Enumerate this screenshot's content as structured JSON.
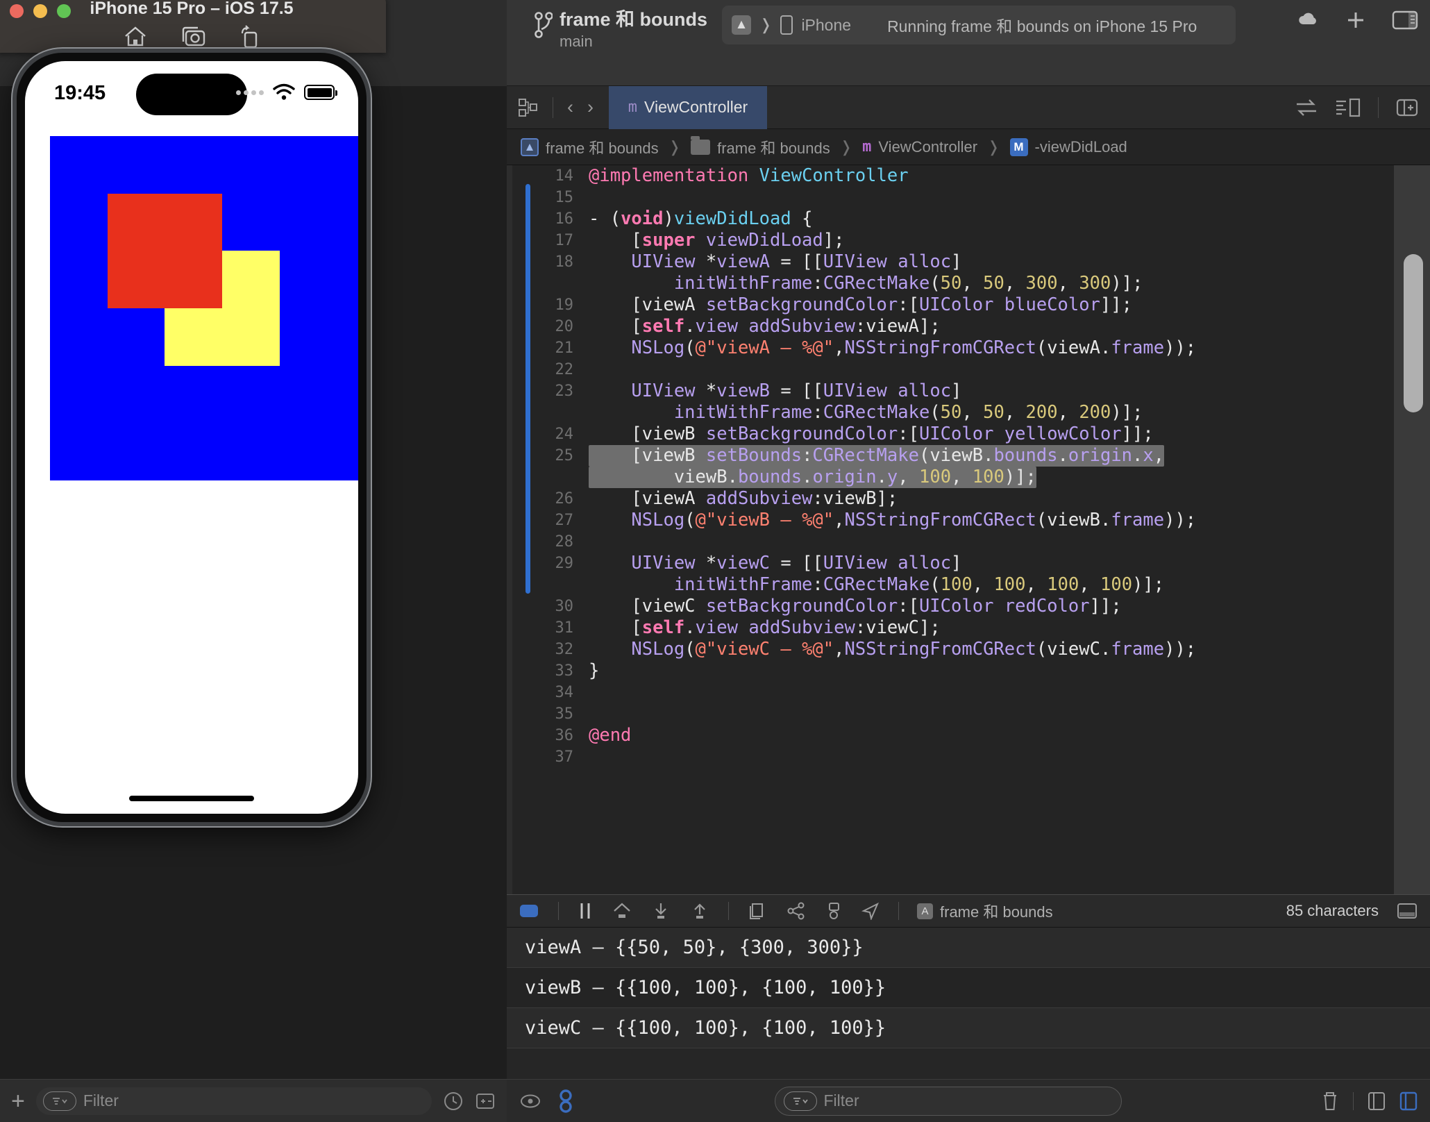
{
  "simulator": {
    "title": "iPhone 15 Pro – iOS 17.5",
    "toolbar": [
      {
        "name": "home-icon",
        "label": "Home"
      },
      {
        "name": "screenshot-icon",
        "label": "Screenshot"
      },
      {
        "name": "rotate-icon",
        "label": "Rotate"
      }
    ],
    "traffic_lights": [
      "close",
      "minimize",
      "zoom"
    ],
    "status_bar": {
      "time": "19:45",
      "cellular": "····",
      "wifi": "wifi-icon",
      "battery": "battery-full-icon"
    },
    "views": [
      {
        "name": "viewA",
        "color": "#0000ff",
        "frame": [
          50,
          50,
          300,
          300
        ]
      },
      {
        "name": "viewB",
        "color": "#ffff66",
        "frame": [
          100,
          100,
          100,
          100
        ]
      },
      {
        "name": "viewC",
        "color": "#e8301c",
        "frame": [
          100,
          100,
          100,
          100
        ]
      }
    ]
  },
  "xcode": {
    "branch": {
      "project": "frame 和 bounds",
      "branch": "main"
    },
    "scheme": {
      "app_icon": "A",
      "destination": "iPhone",
      "status": "Running frame 和 bounds on iPhone 15 Pro"
    },
    "toolbar_right": [
      {
        "name": "cloud-icon"
      },
      {
        "name": "add-icon",
        "label": "+"
      },
      {
        "name": "inspector-toggle-icon"
      }
    ],
    "jumpbar": {
      "related-items-icon": "related-items",
      "back_label": "‹",
      "forward_label": "›",
      "tab": {
        "kind": "m",
        "label": "ViewController"
      },
      "right_icons": [
        "compare-versions-icon",
        "minimap-icon",
        "add-editor-icon"
      ]
    },
    "breadcrumb": [
      {
        "icon": "project-icon",
        "label": "frame 和 bounds"
      },
      {
        "icon": "folder-icon",
        "label": "frame 和 bounds"
      },
      {
        "icon": "m-file-icon",
        "label": "ViewController"
      },
      {
        "icon": "method-icon",
        "label": "-viewDidLoad"
      }
    ],
    "code_lines": [
      {
        "num": "14",
        "tokens": [
          [
            "kw",
            "@implementation"
          ],
          [
            "pl",
            " "
          ],
          [
            "tp",
            "ViewController"
          ]
        ]
      },
      {
        "num": "15",
        "tokens": []
      },
      {
        "num": "16",
        "tokens": [
          [
            "pl",
            "- ("
          ],
          [
            "k",
            "void"
          ],
          [
            "pl",
            ")"
          ],
          [
            "tp",
            "viewDidLoad"
          ],
          [
            "pl",
            " {"
          ]
        ]
      },
      {
        "num": "17",
        "tokens": [
          [
            "pl",
            "    ["
          ],
          [
            "k",
            "super"
          ],
          [
            "pl",
            " "
          ],
          [
            "id",
            "viewDidLoad"
          ],
          [
            "pl",
            "];"
          ]
        ]
      },
      {
        "num": "18",
        "tokens": [
          [
            "pl",
            "    "
          ],
          [
            "id",
            "UIView"
          ],
          [
            "pl",
            " *"
          ],
          [
            "id",
            "viewA"
          ],
          [
            "pl",
            " = [["
          ],
          [
            "id",
            "UIView"
          ],
          [
            "pl",
            " "
          ],
          [
            "id",
            "alloc"
          ],
          [
            "pl",
            "]"
          ]
        ]
      },
      {
        "num": "",
        "tokens": [
          [
            "pl",
            "        "
          ],
          [
            "id",
            "initWithFrame"
          ],
          [
            "pl",
            ":"
          ],
          [
            "id",
            "CGRectMake"
          ],
          [
            "pl",
            "("
          ],
          [
            "nm",
            "50"
          ],
          [
            "pl",
            ", "
          ],
          [
            "nm",
            "50"
          ],
          [
            "pl",
            ", "
          ],
          [
            "nm",
            "300"
          ],
          [
            "pl",
            ", "
          ],
          [
            "nm",
            "300"
          ],
          [
            "pl",
            ")];"
          ]
        ]
      },
      {
        "num": "19",
        "tokens": [
          [
            "pl",
            "    ["
          ],
          [
            "pl",
            "viewA"
          ],
          [
            "pl",
            " "
          ],
          [
            "id",
            "setBackgroundColor"
          ],
          [
            "pl",
            ":["
          ],
          [
            "id",
            "UIColor"
          ],
          [
            "pl",
            " "
          ],
          [
            "id",
            "blueColor"
          ],
          [
            "pl",
            "]];"
          ]
        ]
      },
      {
        "num": "20",
        "tokens": [
          [
            "pl",
            "    ["
          ],
          [
            "k",
            "self"
          ],
          [
            "pl",
            "."
          ],
          [
            "id",
            "view"
          ],
          [
            "pl",
            " "
          ],
          [
            "id",
            "addSubview"
          ],
          [
            "pl",
            ":"
          ],
          [
            "pl",
            "viewA"
          ],
          [
            "pl",
            "];"
          ]
        ]
      },
      {
        "num": "21",
        "tokens": [
          [
            "pl",
            "    "
          ],
          [
            "id",
            "NSLog"
          ],
          [
            "pl",
            "("
          ],
          [
            "st",
            "@\"viewA — %@\""
          ],
          [
            "pl",
            ","
          ],
          [
            "id",
            "NSStringFromCGRect"
          ],
          [
            "pl",
            "("
          ],
          [
            "pl",
            "viewA"
          ],
          [
            "pl",
            "."
          ],
          [
            "id",
            "frame"
          ],
          [
            "pl",
            "));"
          ]
        ]
      },
      {
        "num": "22",
        "tokens": []
      },
      {
        "num": "23",
        "tokens": [
          [
            "pl",
            "    "
          ],
          [
            "id",
            "UIView"
          ],
          [
            "pl",
            " *"
          ],
          [
            "id",
            "viewB"
          ],
          [
            "pl",
            " = [["
          ],
          [
            "id",
            "UIView"
          ],
          [
            "pl",
            " "
          ],
          [
            "id",
            "alloc"
          ],
          [
            "pl",
            "]"
          ]
        ]
      },
      {
        "num": "",
        "tokens": [
          [
            "pl",
            "        "
          ],
          [
            "id",
            "initWithFrame"
          ],
          [
            "pl",
            ":"
          ],
          [
            "id",
            "CGRectMake"
          ],
          [
            "pl",
            "("
          ],
          [
            "nm",
            "50"
          ],
          [
            "pl",
            ", "
          ],
          [
            "nm",
            "50"
          ],
          [
            "pl",
            ", "
          ],
          [
            "nm",
            "200"
          ],
          [
            "pl",
            ", "
          ],
          [
            "nm",
            "200"
          ],
          [
            "pl",
            ")];"
          ]
        ]
      },
      {
        "num": "24",
        "tokens": [
          [
            "pl",
            "    ["
          ],
          [
            "pl",
            "viewB"
          ],
          [
            "pl",
            " "
          ],
          [
            "id",
            "setBackgroundColor"
          ],
          [
            "pl",
            ":["
          ],
          [
            "id",
            "UIColor"
          ],
          [
            "pl",
            " "
          ],
          [
            "id",
            "yellowColor"
          ],
          [
            "pl",
            "]];"
          ]
        ]
      },
      {
        "num": "25",
        "highlight": true,
        "tokens": [
          [
            "pl",
            "    ["
          ],
          [
            "pl",
            "viewB"
          ],
          [
            "pl",
            " "
          ],
          [
            "id",
            "setBounds"
          ],
          [
            "pl",
            ":"
          ],
          [
            "id",
            "CGRectMake"
          ],
          [
            "pl",
            "("
          ],
          [
            "pl",
            "viewB"
          ],
          [
            "pl",
            "."
          ],
          [
            "id",
            "bounds"
          ],
          [
            "pl",
            "."
          ],
          [
            "id",
            "origin"
          ],
          [
            "pl",
            "."
          ],
          [
            "id",
            "x"
          ],
          [
            "pl",
            ","
          ]
        ]
      },
      {
        "num": "",
        "highlight": true,
        "tokens": [
          [
            "pl",
            "        viewB"
          ],
          [
            "pl",
            "."
          ],
          [
            "id",
            "bounds"
          ],
          [
            "pl",
            "."
          ],
          [
            "id",
            "origin"
          ],
          [
            "pl",
            "."
          ],
          [
            "id",
            "y"
          ],
          [
            "pl",
            ", "
          ],
          [
            "nm",
            "100"
          ],
          [
            "pl",
            ", "
          ],
          [
            "nm",
            "100"
          ],
          [
            "pl",
            ")];"
          ]
        ]
      },
      {
        "num": "26",
        "tokens": [
          [
            "pl",
            "    ["
          ],
          [
            "pl",
            "viewA"
          ],
          [
            "pl",
            " "
          ],
          [
            "id",
            "addSubview"
          ],
          [
            "pl",
            ":"
          ],
          [
            "pl",
            "viewB"
          ],
          [
            "pl",
            "];"
          ]
        ]
      },
      {
        "num": "27",
        "tokens": [
          [
            "pl",
            "    "
          ],
          [
            "id",
            "NSLog"
          ],
          [
            "pl",
            "("
          ],
          [
            "st",
            "@\"viewB — %@\""
          ],
          [
            "pl",
            ","
          ],
          [
            "id",
            "NSStringFromCGRect"
          ],
          [
            "pl",
            "("
          ],
          [
            "pl",
            "viewB"
          ],
          [
            "pl",
            "."
          ],
          [
            "id",
            "frame"
          ],
          [
            "pl",
            "));"
          ]
        ]
      },
      {
        "num": "28",
        "tokens": []
      },
      {
        "num": "29",
        "tokens": [
          [
            "pl",
            "    "
          ],
          [
            "id",
            "UIView"
          ],
          [
            "pl",
            " *"
          ],
          [
            "id",
            "viewC"
          ],
          [
            "pl",
            " = [["
          ],
          [
            "id",
            "UIView"
          ],
          [
            "pl",
            " "
          ],
          [
            "id",
            "alloc"
          ],
          [
            "pl",
            "]"
          ]
        ]
      },
      {
        "num": "",
        "tokens": [
          [
            "pl",
            "        "
          ],
          [
            "id",
            "initWithFrame"
          ],
          [
            "pl",
            ":"
          ],
          [
            "id",
            "CGRectMake"
          ],
          [
            "pl",
            "("
          ],
          [
            "nm",
            "100"
          ],
          [
            "pl",
            ", "
          ],
          [
            "nm",
            "100"
          ],
          [
            "pl",
            ", "
          ],
          [
            "nm",
            "100"
          ],
          [
            "pl",
            ", "
          ],
          [
            "nm",
            "100"
          ],
          [
            "pl",
            ")];"
          ]
        ]
      },
      {
        "num": "30",
        "tokens": [
          [
            "pl",
            "    ["
          ],
          [
            "pl",
            "viewC"
          ],
          [
            "pl",
            " "
          ],
          [
            "id",
            "setBackgroundColor"
          ],
          [
            "pl",
            ":["
          ],
          [
            "id",
            "UIColor"
          ],
          [
            "pl",
            " "
          ],
          [
            "id",
            "redColor"
          ],
          [
            "pl",
            "]];"
          ]
        ]
      },
      {
        "num": "31",
        "tokens": [
          [
            "pl",
            "    ["
          ],
          [
            "k",
            "self"
          ],
          [
            "pl",
            "."
          ],
          [
            "id",
            "view"
          ],
          [
            "pl",
            " "
          ],
          [
            "id",
            "addSubview"
          ],
          [
            "pl",
            ":"
          ],
          [
            "pl",
            "viewC"
          ],
          [
            "pl",
            "];"
          ]
        ]
      },
      {
        "num": "32",
        "tokens": [
          [
            "pl",
            "    "
          ],
          [
            "id",
            "NSLog"
          ],
          [
            "pl",
            "("
          ],
          [
            "st",
            "@\"viewC — %@\""
          ],
          [
            "pl",
            ","
          ],
          [
            "id",
            "NSStringFromCGRect"
          ],
          [
            "pl",
            "("
          ],
          [
            "pl",
            "viewC"
          ],
          [
            "pl",
            "."
          ],
          [
            "id",
            "frame"
          ],
          [
            "pl",
            "));"
          ]
        ]
      },
      {
        "num": "33",
        "tokens": [
          [
            "pl",
            "}"
          ]
        ]
      },
      {
        "num": "34",
        "tokens": []
      },
      {
        "num": "35",
        "tokens": []
      },
      {
        "num": "36",
        "tokens": [
          [
            "kw",
            "@end"
          ]
        ]
      },
      {
        "num": "37",
        "tokens": []
      }
    ],
    "debug_bar": {
      "icons": [
        "console-toggle-icon",
        "pause-icon",
        "step-over-icon",
        "step-into-icon",
        "step-out-icon",
        "view-hierarchy-icon",
        "memory-graph-icon",
        "environment-icon",
        "location-icon"
      ],
      "app_icon": "A",
      "app_label": "frame 和 bounds",
      "characters": "85 characters",
      "right_icon": "console-split-icon"
    },
    "console": [
      "viewA — {{50, 50}, {300, 300}}",
      "viewB — {{100, 100}, {100, 100}}",
      "viewC — {{100, 100}, {100, 100}}"
    ],
    "console_bar": {
      "eye_icon": "eye-icon",
      "debug_icon": "debug-levels-icon",
      "filter_placeholder": "Filter",
      "trash_icon": "trash-icon",
      "left_panel_icon": "variables-pane-icon",
      "right_panel_icon": "console-pane-icon"
    },
    "navigator_bar": {
      "add_label": "+",
      "filter_placeholder": "Filter",
      "recent_icon": "clock-icon",
      "adjust_icon": "plus-minus-icon"
    }
  }
}
